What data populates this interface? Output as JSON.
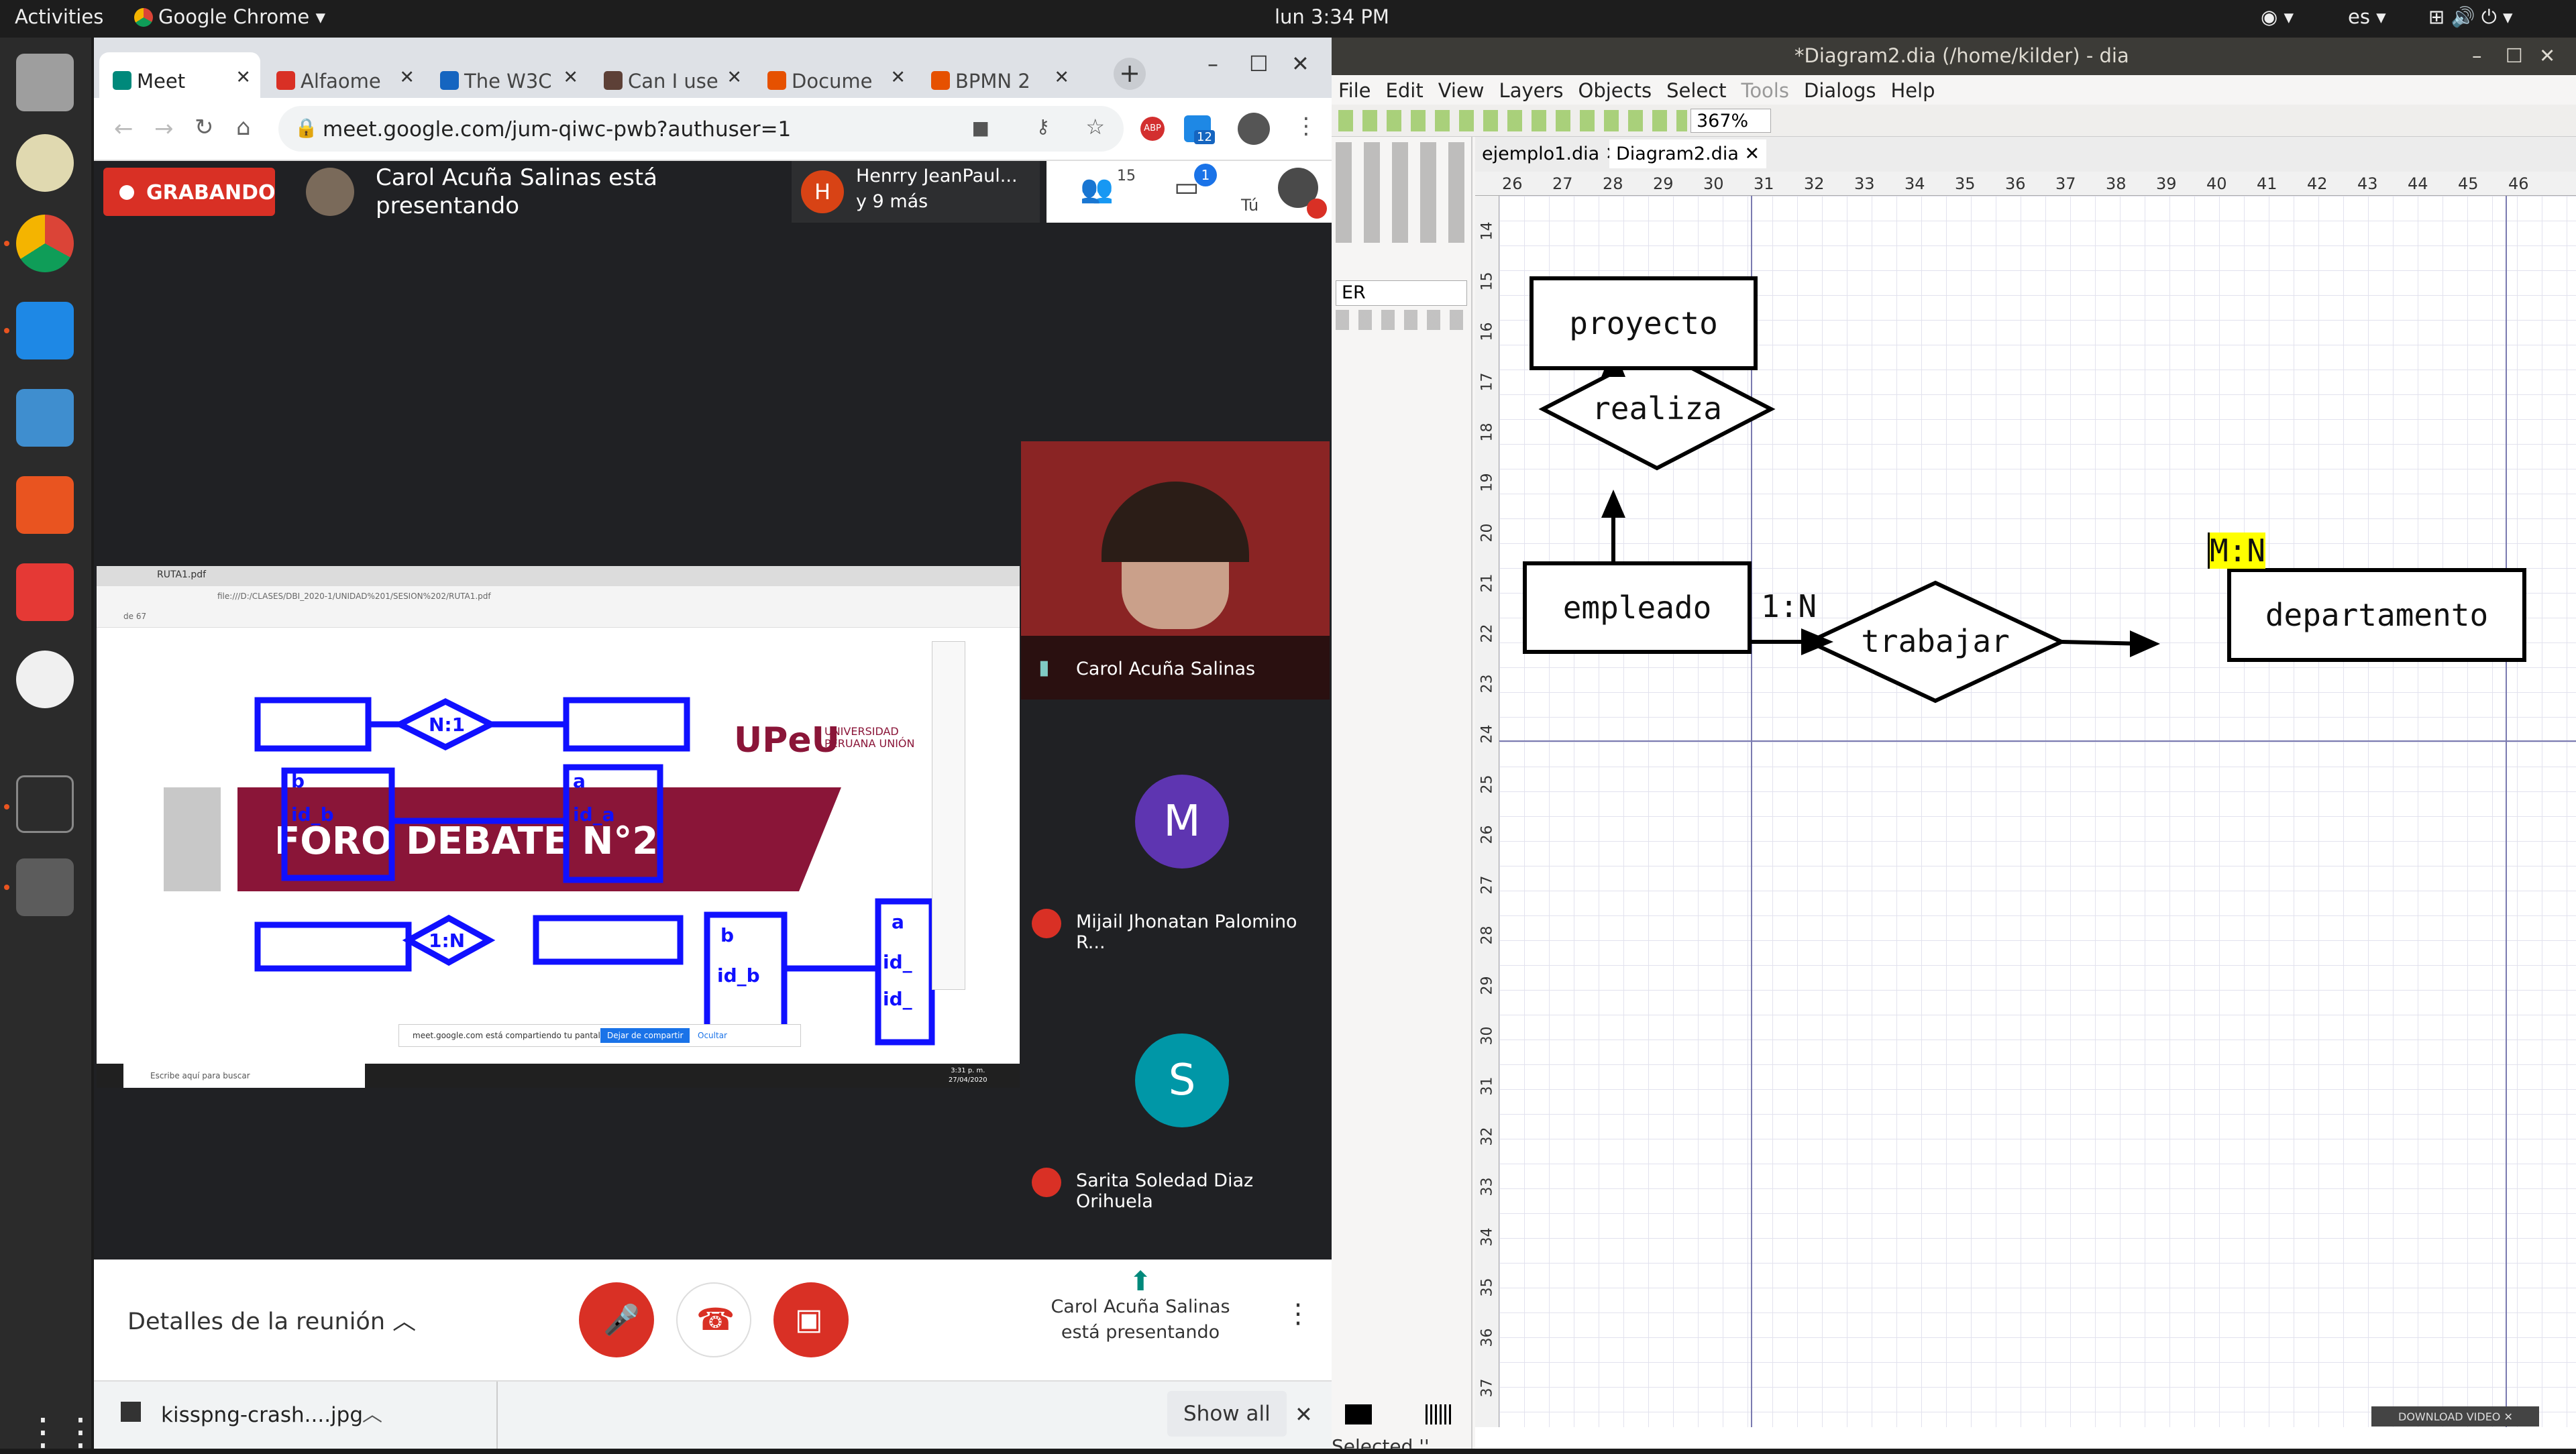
{
  "topbar": {
    "activities": "Activities",
    "app": "Google Chrome",
    "clock": "lun  3:34 PM",
    "lang": "es"
  },
  "chrome": {
    "tabs": [
      {
        "label": "Meet",
        "icon": "meet-icon",
        "color": "#00897b"
      },
      {
        "label": "Alfaome",
        "icon": "alfaomega-icon",
        "color": "#d93025"
      },
      {
        "label": "The W3C",
        "icon": "w3-icon",
        "color": "#1565c0"
      },
      {
        "label": "Can I use",
        "icon": "caniuse-icon",
        "color": "#5d4037"
      },
      {
        "label": "Docume",
        "icon": "document-icon",
        "color": "#e65100"
      },
      {
        "label": "BPMN 2",
        "icon": "bpmn-icon",
        "color": "#e65100"
      }
    ],
    "url": "meet.google.com/jum-qiwc-pwb?authuser=1",
    "extension_badge": "12"
  },
  "meet": {
    "recording": "GRABANDO",
    "presenter_line1": "Carol Acuña Salinas está",
    "presenter_line2": "presentando",
    "others_line1": "Henrry JeanPaul...",
    "others_line2": "y 9 más",
    "others_initial": "H",
    "people_count": "15",
    "chat_count": "1",
    "self_label": "Tú",
    "participants": [
      {
        "name": "Carol Acuña Salinas",
        "initial": "",
        "color": "#6b2b2b"
      },
      {
        "name": "Mijail Jhonatan Palomino R...",
        "initial": "M",
        "color": "#5e35b1"
      },
      {
        "name": "Sarita Soledad Diaz Orihuela",
        "initial": "S",
        "color": "#0097a7"
      }
    ],
    "meeting_details": "Detalles de la reunión",
    "presenting_line1": "Carol Acuña Salinas",
    "presenting_line2": "está presentando"
  },
  "shared": {
    "file": "RUTA1.pdf",
    "address": "file:///D:/CLASES/DBI_2020-1/UNIDAD%201/SESION%202/RUTA1.pdf",
    "page": "de 67",
    "brand": "UPeU",
    "brand_sub1": "UNIVERSIDAD",
    "brand_sub2": "PERUANA UNIÓN",
    "banner": "FORO DEBATE N°2",
    "labels": {
      "n1": "N:1",
      "one_n": "1:N",
      "a": "a",
      "id_a": "id_a",
      "b": "b",
      "id_b": "id_b",
      "b2": "b",
      "id_b2": "id_b",
      "a2": "a",
      "id_1": "id_",
      "id_2": "id_"
    },
    "share_msg": "meet.google.com está compartiendo tu pantalla.",
    "stop_share": "Dejar de compartir",
    "hide": "Ocultar",
    "taskbar_search": "Escribe aquí para buscar",
    "win_time": "3:31 p. m.",
    "win_date": "27/04/2020"
  },
  "downloads": {
    "file": "kisspng-crash....jpg",
    "show_all": "Show all"
  },
  "dia": {
    "title": "*Diagram2.dia (/home/kilder) - dia",
    "menu": [
      "File",
      "Edit",
      "View",
      "Layers",
      "Objects",
      "Select",
      "Tools",
      "Dialogs",
      "Help"
    ],
    "zoom": "367%",
    "tabs": [
      "ejemplo1.dia",
      "Diagram2.dia"
    ],
    "sheet": "ER",
    "ruler_top": [
      "26",
      "27",
      "28",
      "29",
      "30",
      "31",
      "32",
      "33",
      "34",
      "35",
      "36",
      "37",
      "38",
      "39",
      "40",
      "41",
      "42",
      "43",
      "44",
      "45",
      "46"
    ],
    "ruler_left": [
      "14",
      "15",
      "16",
      "17",
      "18",
      "19",
      "20",
      "21",
      "22",
      "23",
      "24",
      "25",
      "26",
      "27",
      "28",
      "29",
      "30",
      "31",
      "32",
      "33",
      "34",
      "35",
      "36",
      "37"
    ],
    "entities": {
      "proyecto": "proyecto",
      "empleado": "empleado",
      "departamento": "departamento"
    },
    "relations": {
      "realiza": "realiza",
      "trabajar": "trabajar"
    },
    "cardinality_1": "1:N",
    "cardinality_2": "M:N",
    "status": "Selected ''",
    "download_video": "DOWNLOAD VIDEO"
  }
}
